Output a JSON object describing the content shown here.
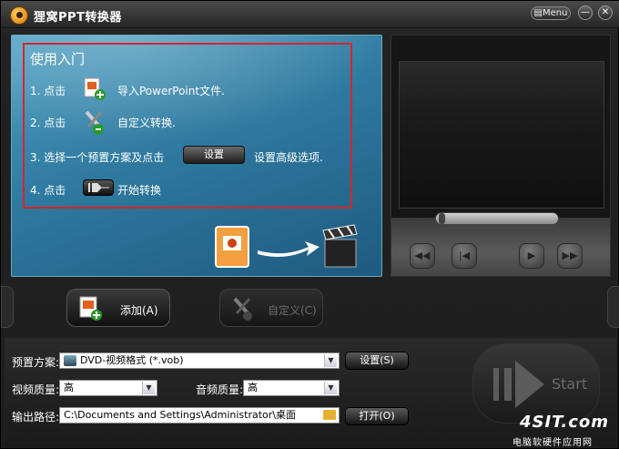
{
  "window": {
    "title": "狸窝PPT转换器",
    "menu_label": "Menu",
    "minimize_glyph": "—",
    "close_glyph": "✕"
  },
  "guide": {
    "title": "使用入门",
    "steps": [
      {
        "prefix": "1. 点击",
        "text": "导入PowerPoint文件."
      },
      {
        "prefix": "2. 点击",
        "text": "自定义转换."
      },
      {
        "prefix": "3. 选择一个预置方案及点击",
        "button": "设置",
        "text": "设置高级选项."
      },
      {
        "prefix": "4. 点击",
        "text": "开始转换"
      }
    ]
  },
  "actions": {
    "add_label": "添加(A)",
    "custom_label": "自定义(C)"
  },
  "settings": {
    "preset_label": "预置方案:",
    "preset_value": "DVD-视频格式 (*.vob)",
    "preset_button": "设置(S)",
    "video_quality_label": "视频质量:",
    "video_quality_value": "高",
    "audio_quality_label": "音频质量:",
    "audio_quality_value": "高",
    "output_path_label": "输出路径:",
    "output_path_value": "C:\\Documents and Settings\\Administrator\\桌面",
    "open_button": "打开(O)"
  },
  "start": {
    "label": "Start"
  },
  "watermark": {
    "site": "4SIT.com",
    "tagline": "电脑软硬件应用网"
  },
  "icons": [
    "app-logo-icon",
    "menu-icon",
    "import-ppt-icon",
    "custom-tools-icon",
    "start-icon",
    "ppt-file-icon",
    "arrow-icon",
    "clapperboard-icon",
    "dvd-icon",
    "folder-icon",
    "dropdown-arrow-icon"
  ]
}
